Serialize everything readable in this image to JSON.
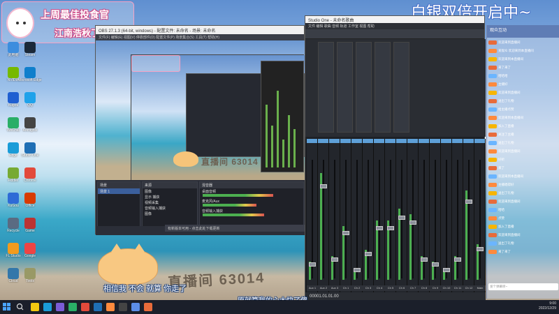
{
  "overlay": {
    "banner_line1": "上周最佳投食官",
    "banner_line2": "江南浩秋了",
    "promo": "白银双倍开启中~",
    "room_watermark": "直播间 63014",
    "caption1": "相信我 不会 就算 你走了",
    "caption2": "原就算我的心太快了傻"
  },
  "desktop_icons": [
    {
      "label": "此电脑",
      "color": "#3c8dde"
    },
    {
      "label": "Steam",
      "color": "#1b2838"
    },
    {
      "label": "NVIDIA",
      "color": "#76b900"
    },
    {
      "label": "Microsoft Edge",
      "color": "#0f7fcc"
    },
    {
      "label": "Kugou",
      "color": "#1f5fd1"
    },
    {
      "label": "QQ",
      "color": "#1fa2ea"
    },
    {
      "label": "WeChat",
      "color": "#2aae67"
    },
    {
      "label": "Arknights",
      "color": "#444"
    },
    {
      "label": "Edge",
      "color": "#1a9cd8"
    },
    {
      "label": "Studio One",
      "color": "#1f6fb5"
    },
    {
      "label": "Fiddler",
      "color": "#7a3"
    },
    {
      "label": "Chrome",
      "color": "#e24a3b"
    },
    {
      "label": "KuGou",
      "color": "#2e6bd6"
    },
    {
      "label": "Office",
      "color": "#d83b01"
    },
    {
      "label": "Recycle",
      "color": "#5a6b82"
    },
    {
      "label": "Game",
      "color": "#b33"
    },
    {
      "label": "FL Studio",
      "color": "#f29b1e"
    },
    {
      "label": "Google",
      "color": "#e44"
    },
    {
      "label": "Cloud",
      "color": "#37a"
    },
    {
      "label": "Tools",
      "color": "#996"
    }
  ],
  "obs": {
    "title": "OBS 27.1.3 (64-bit, windows) - 配置文件: 未命名 - 场景: 未命名",
    "menu": "文件(F)  编辑(E)  视图(V)  停靠部件(D)  配置文件(P)  场景集合(S)  工具(T)  帮助(H)",
    "scenes_title": "场景",
    "scenes": [
      "场景 1"
    ],
    "sources_title": "来源",
    "sources": [
      "图像",
      "显示 捕获",
      "视频采集",
      "音频输入捕获",
      "图像"
    ],
    "mixer_title": "混音器",
    "mixer": [
      {
        "name": "桌面音频",
        "level": 0.72
      },
      {
        "name": "麦克风/Aux",
        "level": 0.55
      },
      {
        "name": "音频输入捕获",
        "level": 0.63
      }
    ],
    "status": "LIVE: 00:00:00  REC: 00:00:00  CPU: 2.5%, 60.00 fps",
    "notice": "有新版本可用 - 点击此处下载更新"
  },
  "studio_one": {
    "title": "Studio One - 未命名歌曲",
    "menu": "文件  编辑  歌曲  音频  轨道  工作室  视图  帮助",
    "channels": [
      "Aux 1",
      "Aux 2",
      "Aux 3",
      "Ch 1",
      "Ch 2",
      "Ch 3",
      "Ch 4",
      "Ch 5",
      "Ch 6",
      "Ch 7",
      "Ch 8",
      "Ch 9",
      "Ch 10",
      "Ch 11",
      "Ch 12",
      "Main"
    ],
    "channel_levels": [
      0.15,
      0.9,
      0.2,
      0.45,
      0.1,
      0.25,
      0.5,
      0.5,
      0.6,
      0.55,
      0.2,
      0.15,
      0.1,
      0.2,
      0.75,
      0.3
    ],
    "time": "00001.01.01.00"
  },
  "chat": {
    "header": "观众互动",
    "rows": [
      {
        "text": "欢迎来到直播间",
        "badge": "#e86b3a"
      },
      {
        "text": "某观众 欢迎来到本直播间",
        "badge": "#ff8a3d"
      },
      {
        "text": "欢迎来到本直播间",
        "badge": "#f7b500"
      },
      {
        "text": "来了来了",
        "badge": "#e86b3a"
      },
      {
        "text": "哈哈哈",
        "badge": "#6bb5ff"
      },
      {
        "text": "主播好",
        "badge": "#ff8a3d"
      },
      {
        "text": "欢迎来到直播间",
        "badge": "#f7b500"
      },
      {
        "text": "送出了礼物",
        "badge": "#e86b3a"
      },
      {
        "text": "给主播点赞",
        "badge": "#6bb5ff"
      },
      {
        "text": "欢迎来到本直播间",
        "badge": "#ff8a3d"
      },
      {
        "text": "加入了直播",
        "badge": "#f7b500"
      },
      {
        "text": "关注了主播",
        "badge": "#e86b3a"
      },
      {
        "text": "送出了礼物",
        "badge": "#6bb5ff"
      },
      {
        "text": "欢迎来到直播间",
        "badge": "#ff8a3d"
      },
      {
        "text": "好听",
        "badge": "#f7b500"
      },
      {
        "text": "来了",
        "badge": "#e86b3a"
      },
      {
        "text": "欢迎来到本直播间",
        "badge": "#6bb5ff"
      },
      {
        "text": "主播唱得好",
        "badge": "#ff8a3d"
      },
      {
        "text": "送出了礼物",
        "badge": "#f7b500"
      },
      {
        "text": "欢迎来到直播间",
        "badge": "#e86b3a"
      },
      {
        "text": "哈哈",
        "badge": "#6bb5ff"
      },
      {
        "text": "点赞",
        "badge": "#ff8a3d"
      },
      {
        "text": "加入了直播",
        "badge": "#f7b500"
      },
      {
        "text": "欢迎来到直播间",
        "badge": "#e86b3a"
      },
      {
        "text": "送出了礼物",
        "badge": "#6bb5ff"
      },
      {
        "text": "来了来了",
        "badge": "#ff8a3d"
      }
    ],
    "input_placeholder": "发个弹幕呗~"
  },
  "taskbar": {
    "apps": [
      "#f2c811",
      "#1a9cd8",
      "#7b5cd6",
      "#2aae67",
      "#e24a3b",
      "#1f6fb5",
      "#ff8a3d",
      "#444",
      "#5c8ee8",
      "#e86b3a"
    ],
    "time": "9:00",
    "date": "2022/12/29"
  }
}
